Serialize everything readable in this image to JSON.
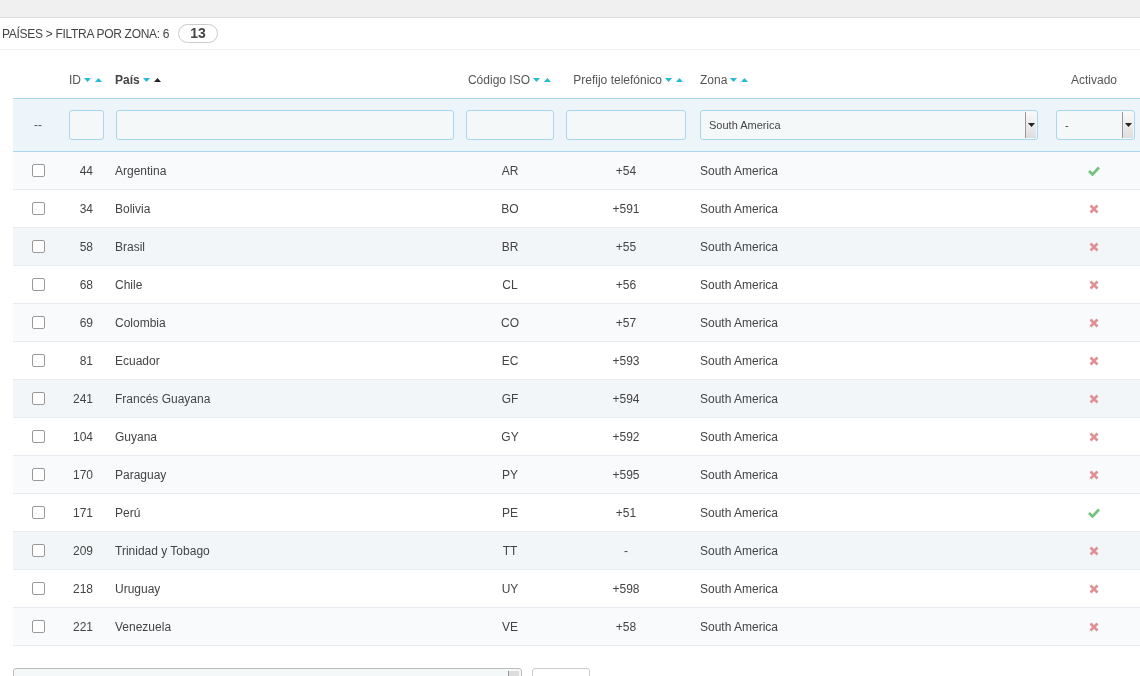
{
  "breadcrumb": {
    "text": "PAÍSES > FILTRA POR ZONA: 6",
    "count": "13"
  },
  "columns": [
    {
      "kind": "sortable",
      "label": "ID",
      "sorted_ascending": false
    },
    {
      "kind": "sortable",
      "label": "País",
      "sorted_ascending": true
    },
    {
      "kind": "sortable",
      "label": "Código ISO",
      "sorted_ascending": false
    },
    {
      "kind": "sortable",
      "label": "Prefijo telefónico",
      "sorted_ascending": false
    },
    {
      "kind": "sortable",
      "label": "Zona",
      "sorted_ascending": false
    },
    {
      "kind": "plain",
      "label": "Activado"
    }
  ],
  "filters": {
    "select_all": "--",
    "zone": "South America",
    "active": "-"
  },
  "rows": [
    {
      "checked": false,
      "cells": [
        "44",
        "Argentina",
        "AR",
        "+54",
        "South America"
      ],
      "enabled": true
    },
    {
      "checked": false,
      "cells": [
        "34",
        "Bolivia",
        "BO",
        "+591",
        "South America"
      ],
      "enabled": false
    },
    {
      "checked": false,
      "cells": [
        "58",
        "Brasil",
        "BR",
        "+55",
        "South America"
      ],
      "enabled": false
    },
    {
      "checked": false,
      "cells": [
        "68",
        "Chile",
        "CL",
        "+56",
        "South America"
      ],
      "enabled": false
    },
    {
      "checked": false,
      "cells": [
        "69",
        "Colombia",
        "CO",
        "+57",
        "South America"
      ],
      "enabled": false
    },
    {
      "checked": false,
      "cells": [
        "81",
        "Ecuador",
        "EC",
        "+593",
        "South America"
      ],
      "enabled": false
    },
    {
      "checked": false,
      "cells": [
        "241",
        "Francés Guayana",
        "GF",
        "+594",
        "South America"
      ],
      "enabled": false
    },
    {
      "checked": false,
      "cells": [
        "104",
        "Guyana",
        "GY",
        "+592",
        "South America"
      ],
      "enabled": false
    },
    {
      "checked": false,
      "cells": [
        "170",
        "Paraguay",
        "PY",
        "+595",
        "South America"
      ],
      "enabled": false
    },
    {
      "checked": false,
      "cells": [
        "171",
        "Perú",
        "PE",
        "+51",
        "South America"
      ],
      "enabled": true
    },
    {
      "checked": false,
      "cells": [
        "209",
        "Trinidad y Tobago",
        "TT",
        "-",
        "South America"
      ],
      "enabled": false
    },
    {
      "checked": false,
      "cells": [
        "218",
        "Uruguay",
        "UY",
        "+598",
        "South America"
      ],
      "enabled": false
    },
    {
      "checked": false,
      "cells": [
        "221",
        "Venezuela",
        "VE",
        "+58",
        "South America"
      ],
      "enabled": false
    }
  ]
}
